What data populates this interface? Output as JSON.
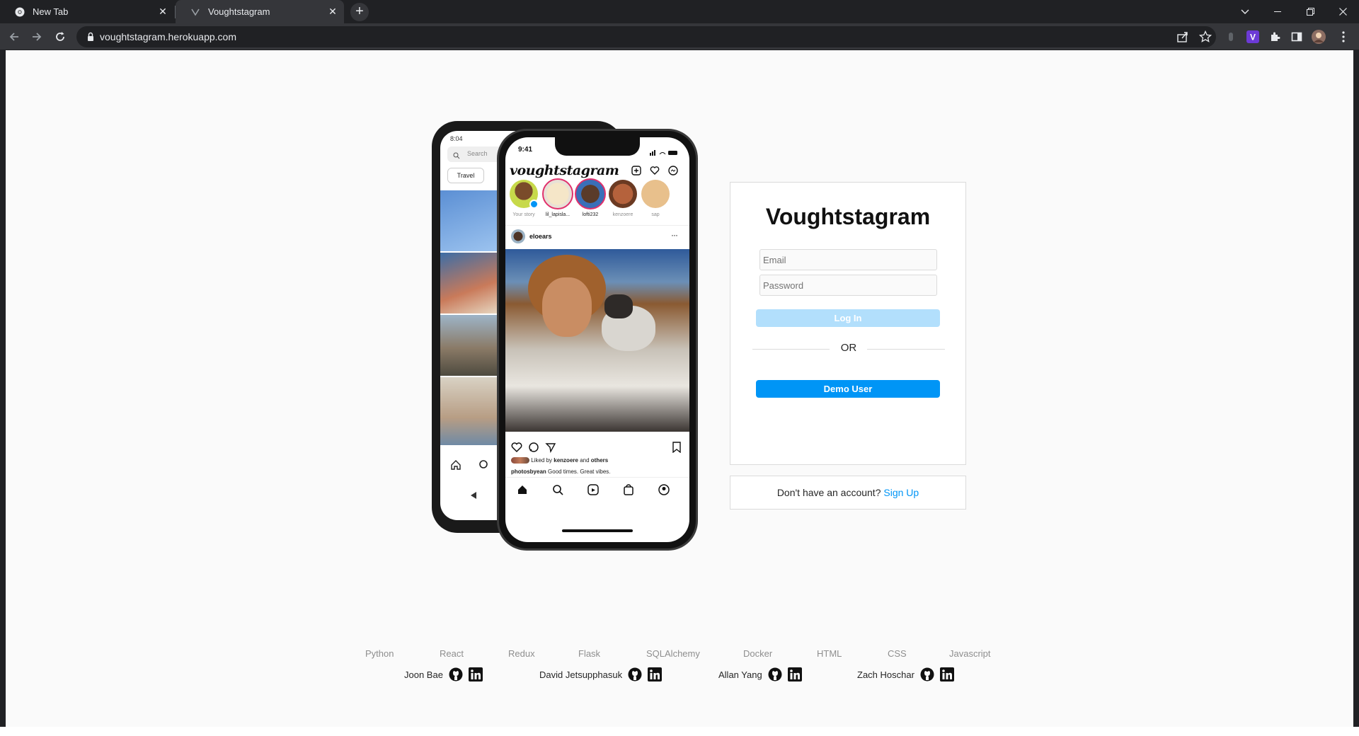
{
  "browser": {
    "tabs": [
      {
        "title": "New Tab",
        "active": false
      },
      {
        "title": "Voughtstagram",
        "active": true
      }
    ],
    "url": "voughtstagram.herokuapp.com"
  },
  "phones": {
    "back": {
      "time": "8:04",
      "search_placeholder": "Search",
      "chip": "Travel"
    },
    "front": {
      "time": "9:41",
      "app_logo": "voughtstagram",
      "stories": [
        "Your story",
        "lil_lapisla...",
        "lofti232",
        "kenzoere",
        "sap"
      ],
      "post_user": "eloears",
      "liked_by_prefix": "Liked by",
      "liked_by_user": "kenzoere",
      "liked_by_and": "and",
      "liked_by_others": "others",
      "caption_user": "photosbyean",
      "caption_text": "Good times. Great vibes."
    }
  },
  "login": {
    "title": "Voughtstagram",
    "email_placeholder": "Email",
    "password_placeholder": "Password",
    "login_button": "Log In",
    "or": "OR",
    "demo_button": "Demo User"
  },
  "signup": {
    "prompt": "Don't have an account?",
    "link": "Sign Up"
  },
  "footer": {
    "technologies": [
      "Python",
      "React",
      "Redux",
      "Flask",
      "SQLAlchemy",
      "Docker",
      "HTML",
      "CSS",
      "Javascript"
    ],
    "developers": [
      "Joon Bae",
      "David Jetsupphasuk",
      "Allan Yang",
      "Zach Hoschar"
    ]
  },
  "colors": {
    "accent": "#0095f6",
    "accent_disabled": "#b2dffc",
    "page_bg": "#fafafa",
    "border": "#dbdbdb",
    "chrome_dark": "#202124",
    "chrome_toolbar": "#35363a"
  }
}
